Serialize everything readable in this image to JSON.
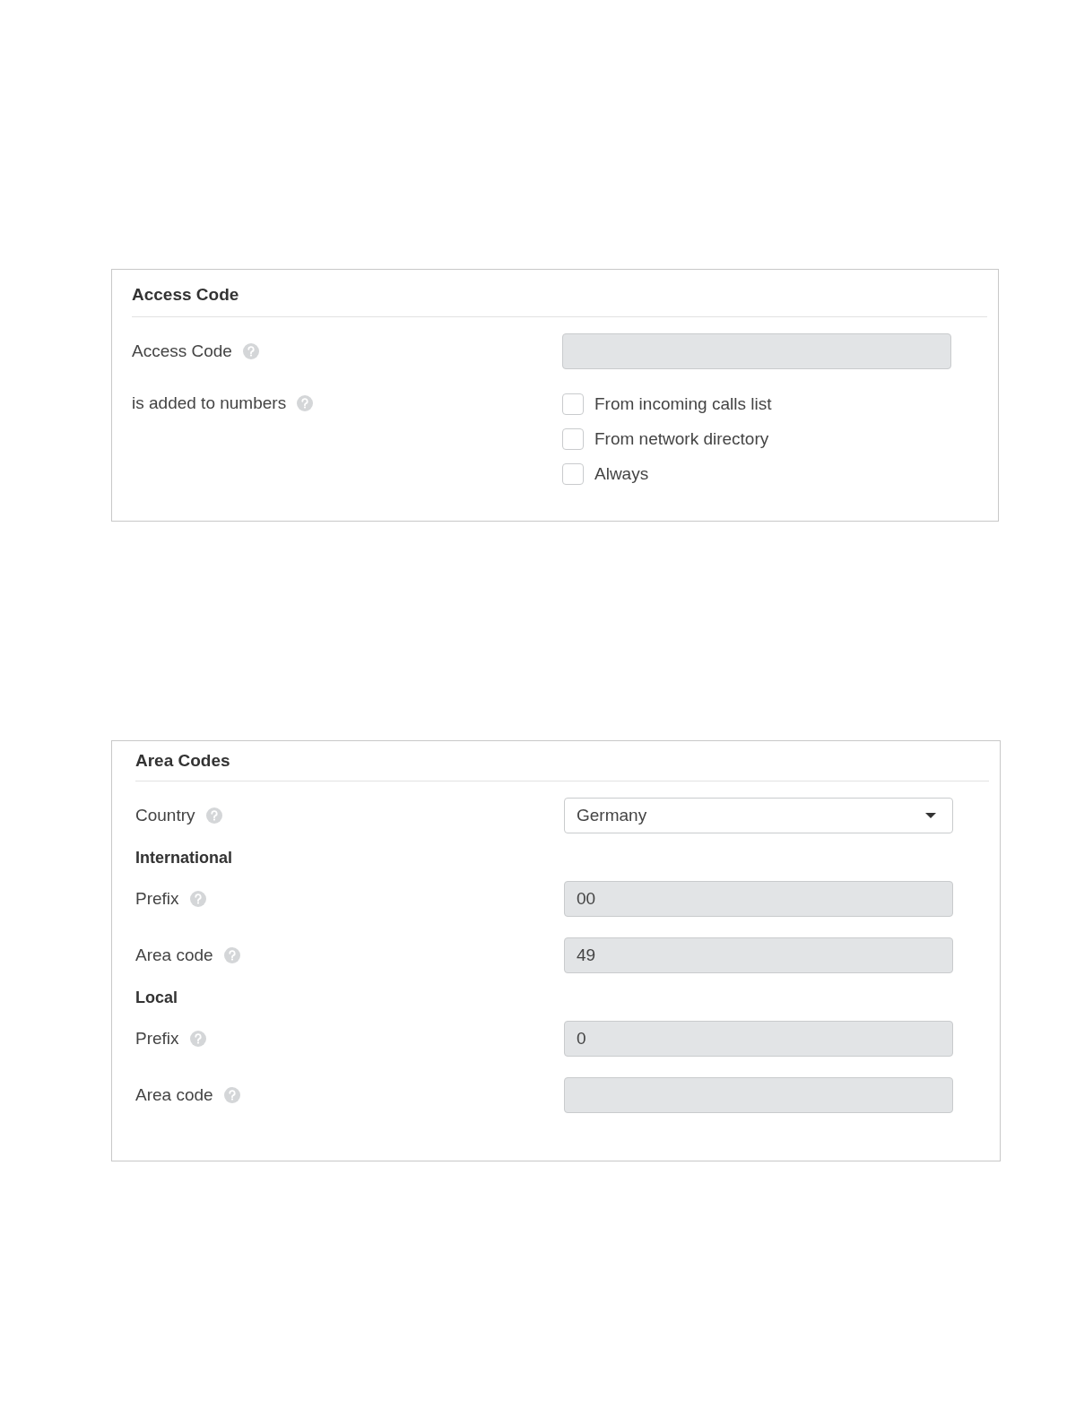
{
  "panels": [
    {
      "title": "Access Code",
      "rows": [
        {
          "kind": "input",
          "label": "Access Code",
          "disabled": true
        },
        {
          "kind": "checks",
          "label": "is added to numbers",
          "options": [
            {
              "label": "From incoming calls list",
              "checked": false
            },
            {
              "label": "From network directory",
              "checked": false
            },
            {
              "label": "Always",
              "checked": false
            }
          ]
        }
      ]
    },
    {
      "title": "Area Codes",
      "rows": [
        {
          "kind": "select",
          "label": "Country",
          "value": "Germany"
        },
        {
          "kind": "heading",
          "label": "International"
        },
        {
          "kind": "input",
          "label": "Prefix",
          "value": "00",
          "disabled": true
        },
        {
          "kind": "input",
          "label": "Area code",
          "value": "49",
          "disabled": true
        },
        {
          "kind": "heading",
          "label": "Local"
        },
        {
          "kind": "input",
          "label": "Prefix",
          "value": "0",
          "disabled": true
        },
        {
          "kind": "input",
          "label": "Area code",
          "disabled": true
        }
      ]
    }
  ]
}
